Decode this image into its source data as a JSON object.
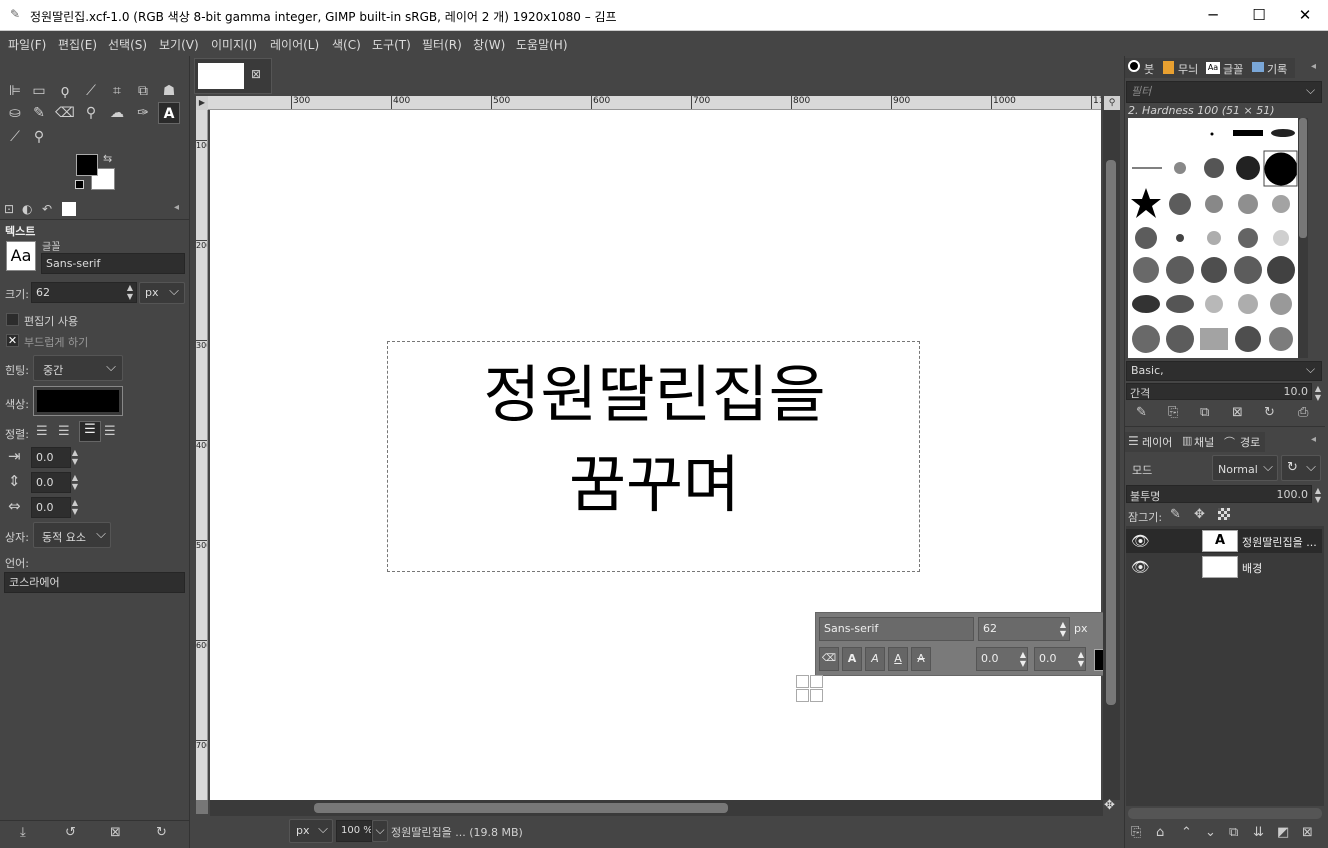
{
  "window": {
    "title": "정원딸린집.xcf-1.0 (RGB 색상 8-bit gamma integer, GIMP built-in sRGB, 레이어 2 개) 1920x1080 – 김프",
    "minimize": "─",
    "maximize": "☐",
    "close": "✕"
  },
  "menu": [
    "파일(F)",
    "편집(E)",
    "선택(S)",
    "보기(V)",
    "이미지(I)",
    "레이어(L)",
    "색(C)",
    "도구(T)",
    "필터(R)",
    "창(W)",
    "도움말(H)"
  ],
  "tool_options": {
    "section_title": "텍스트",
    "font_label": "글꼴",
    "font_preview": "Aa",
    "font_value": "Sans-serif",
    "size_label": "크기:",
    "size_value": "62",
    "size_unit": "px",
    "use_editor_label": "편집기 사용",
    "antialias_label": "부드럽게 하기",
    "hinting_label": "힌팅:",
    "hinting_value": "중간",
    "color_label": "색상:",
    "justify_label": "정렬:",
    "indent_value": "0.0",
    "line_spacing_value": "0.0",
    "letter_spacing_value": "0.0",
    "box_label": "상자:",
    "box_value": "동적 요소",
    "language_label": "언어:",
    "language_value": "코스라에어"
  },
  "canvas": {
    "text_line1": "정원딸린집을",
    "text_line2": "꿈꾸며",
    "ruler_h": [
      "300",
      "400",
      "500",
      "600",
      "700",
      "800",
      "900",
      "1000",
      "1100"
    ],
    "ruler_v": [
      "100",
      "200",
      "300",
      "400",
      "500",
      "600",
      "700"
    ]
  },
  "text_overlay": {
    "font": "Sans-serif",
    "size": "62",
    "unit": "px",
    "baseline": "0.0",
    "kerning": "0.0"
  },
  "status": {
    "unit": "px",
    "zoom": "100 %",
    "info": "정원딸린집을 ... (19.8 MB)"
  },
  "brushes": {
    "tabs": [
      "붓",
      "무늬",
      "글꼴",
      "기록"
    ],
    "filter_placeholder": "필터",
    "current": "2. Hardness 100 (51 × 51)",
    "tag": "Basic,",
    "spacing_label": "간격",
    "spacing_value": "10.0"
  },
  "layers": {
    "tabs": [
      "레이어",
      "채널",
      "경로"
    ],
    "mode_label": "모드",
    "mode_value": "Normal",
    "opacity_label": "불투명",
    "opacity_value": "100.0",
    "lock_label": "잠그기:",
    "items": [
      {
        "name": "정원딸린집을 ..."
      },
      {
        "name": "배경"
      }
    ]
  },
  "colors": {
    "fg": "#000000",
    "bg": "#ffffff",
    "accent": "#000000"
  }
}
